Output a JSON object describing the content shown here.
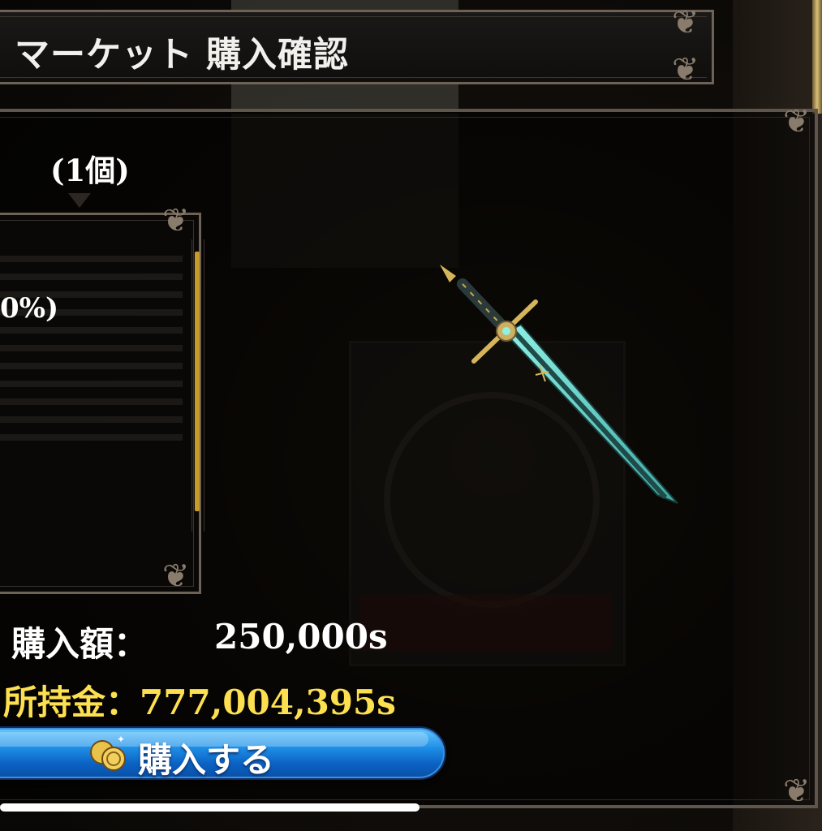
{
  "header": {
    "title": "マーケット 購入確認"
  },
  "item": {
    "quantity_text": "(1個)",
    "description_partial": "0%)",
    "icon": "sword-icon"
  },
  "purchase": {
    "price_label": "購入額：",
    "price_value": "250,000s",
    "money_line": "所持金：777,004,395s",
    "buy_button_label": "購入する",
    "buy_button_icon": "coin-icon"
  },
  "colors": {
    "money_text": "#fde050",
    "button_blue": "#1e8ee6",
    "frame": "#6e6257",
    "scrollbar": "#c89a28"
  },
  "progress": {
    "fraction": 0.51
  }
}
